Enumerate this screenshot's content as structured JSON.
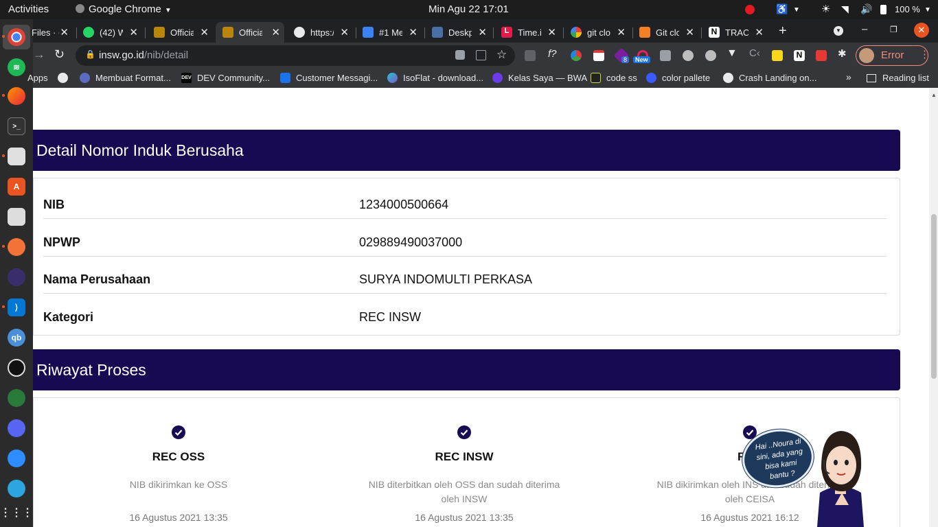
{
  "topbar": {
    "activities": "Activities",
    "app_name": "Google Chrome",
    "clock": "Min Agu 22  17:01",
    "battery": "100 %"
  },
  "tabs": [
    {
      "title": "Files · ("
    },
    {
      "title": "(42) W"
    },
    {
      "title": "Officia"
    },
    {
      "title": "Officia"
    },
    {
      "title": "https:/"
    },
    {
      "title": "#1 Me"
    },
    {
      "title": "Deskp"
    },
    {
      "title": "Time.i"
    },
    {
      "title": "git clo"
    },
    {
      "title": "Git clo"
    },
    {
      "title": "TRACI"
    }
  ],
  "omnibox": {
    "host": "insw.go.id",
    "path": "/nib/detail"
  },
  "profile": {
    "label": "Error"
  },
  "extensions": {
    "badge_count": "8",
    "badge_new": "New"
  },
  "bookmarks": {
    "apps": "Apps",
    "items": [
      {
        "label": "Membuat Format..."
      },
      {
        "label": "DEV Community..."
      },
      {
        "label": "Customer Messagi..."
      },
      {
        "label": "IsoFlat - download..."
      },
      {
        "label": "Kelas Saya — BWA"
      },
      {
        "label": "code ss"
      },
      {
        "label": "color pallete"
      },
      {
        "label": "Crash Landing on..."
      }
    ],
    "more": "»",
    "reading_list": "Reading list"
  },
  "detail": {
    "heading": "Detail Nomor Induk Berusaha",
    "rows": [
      {
        "label": "NIB",
        "value": "1234000500664"
      },
      {
        "label": "NPWP",
        "value": "029889490037000"
      },
      {
        "label": "Nama Perusahaan",
        "value": "SURYA INDOMULTI PERKASA"
      },
      {
        "label": "Kategori",
        "value": "REC INSW"
      }
    ]
  },
  "riwayat": {
    "heading": "Riwayat Proses",
    "steps": [
      {
        "title": "REC OSS",
        "desc": "NIB dikirimkan ke OSS",
        "date": "16 Agustus 2021 13:35"
      },
      {
        "title": "REC INSW",
        "desc": "NIB diterbitkan oleh OSS dan sudah diterima oleh INSW",
        "date": "16 Agustus 2021 13:35"
      },
      {
        "title": "REC",
        "desc": "NIB dikirimkan oleh INS          dan sudah diterima oleh CEISA",
        "date": "16 Agustus 2021 16:12"
      }
    ]
  },
  "chatbot": {
    "bubble": "Hai ..Noura di sini, ada yang bisa kami bantu ?"
  },
  "colors": {
    "header_bg": "#180a52",
    "chrome_dark": "#202124",
    "chrome_toolbar": "#35363a",
    "dock": "#2b2b2b"
  }
}
